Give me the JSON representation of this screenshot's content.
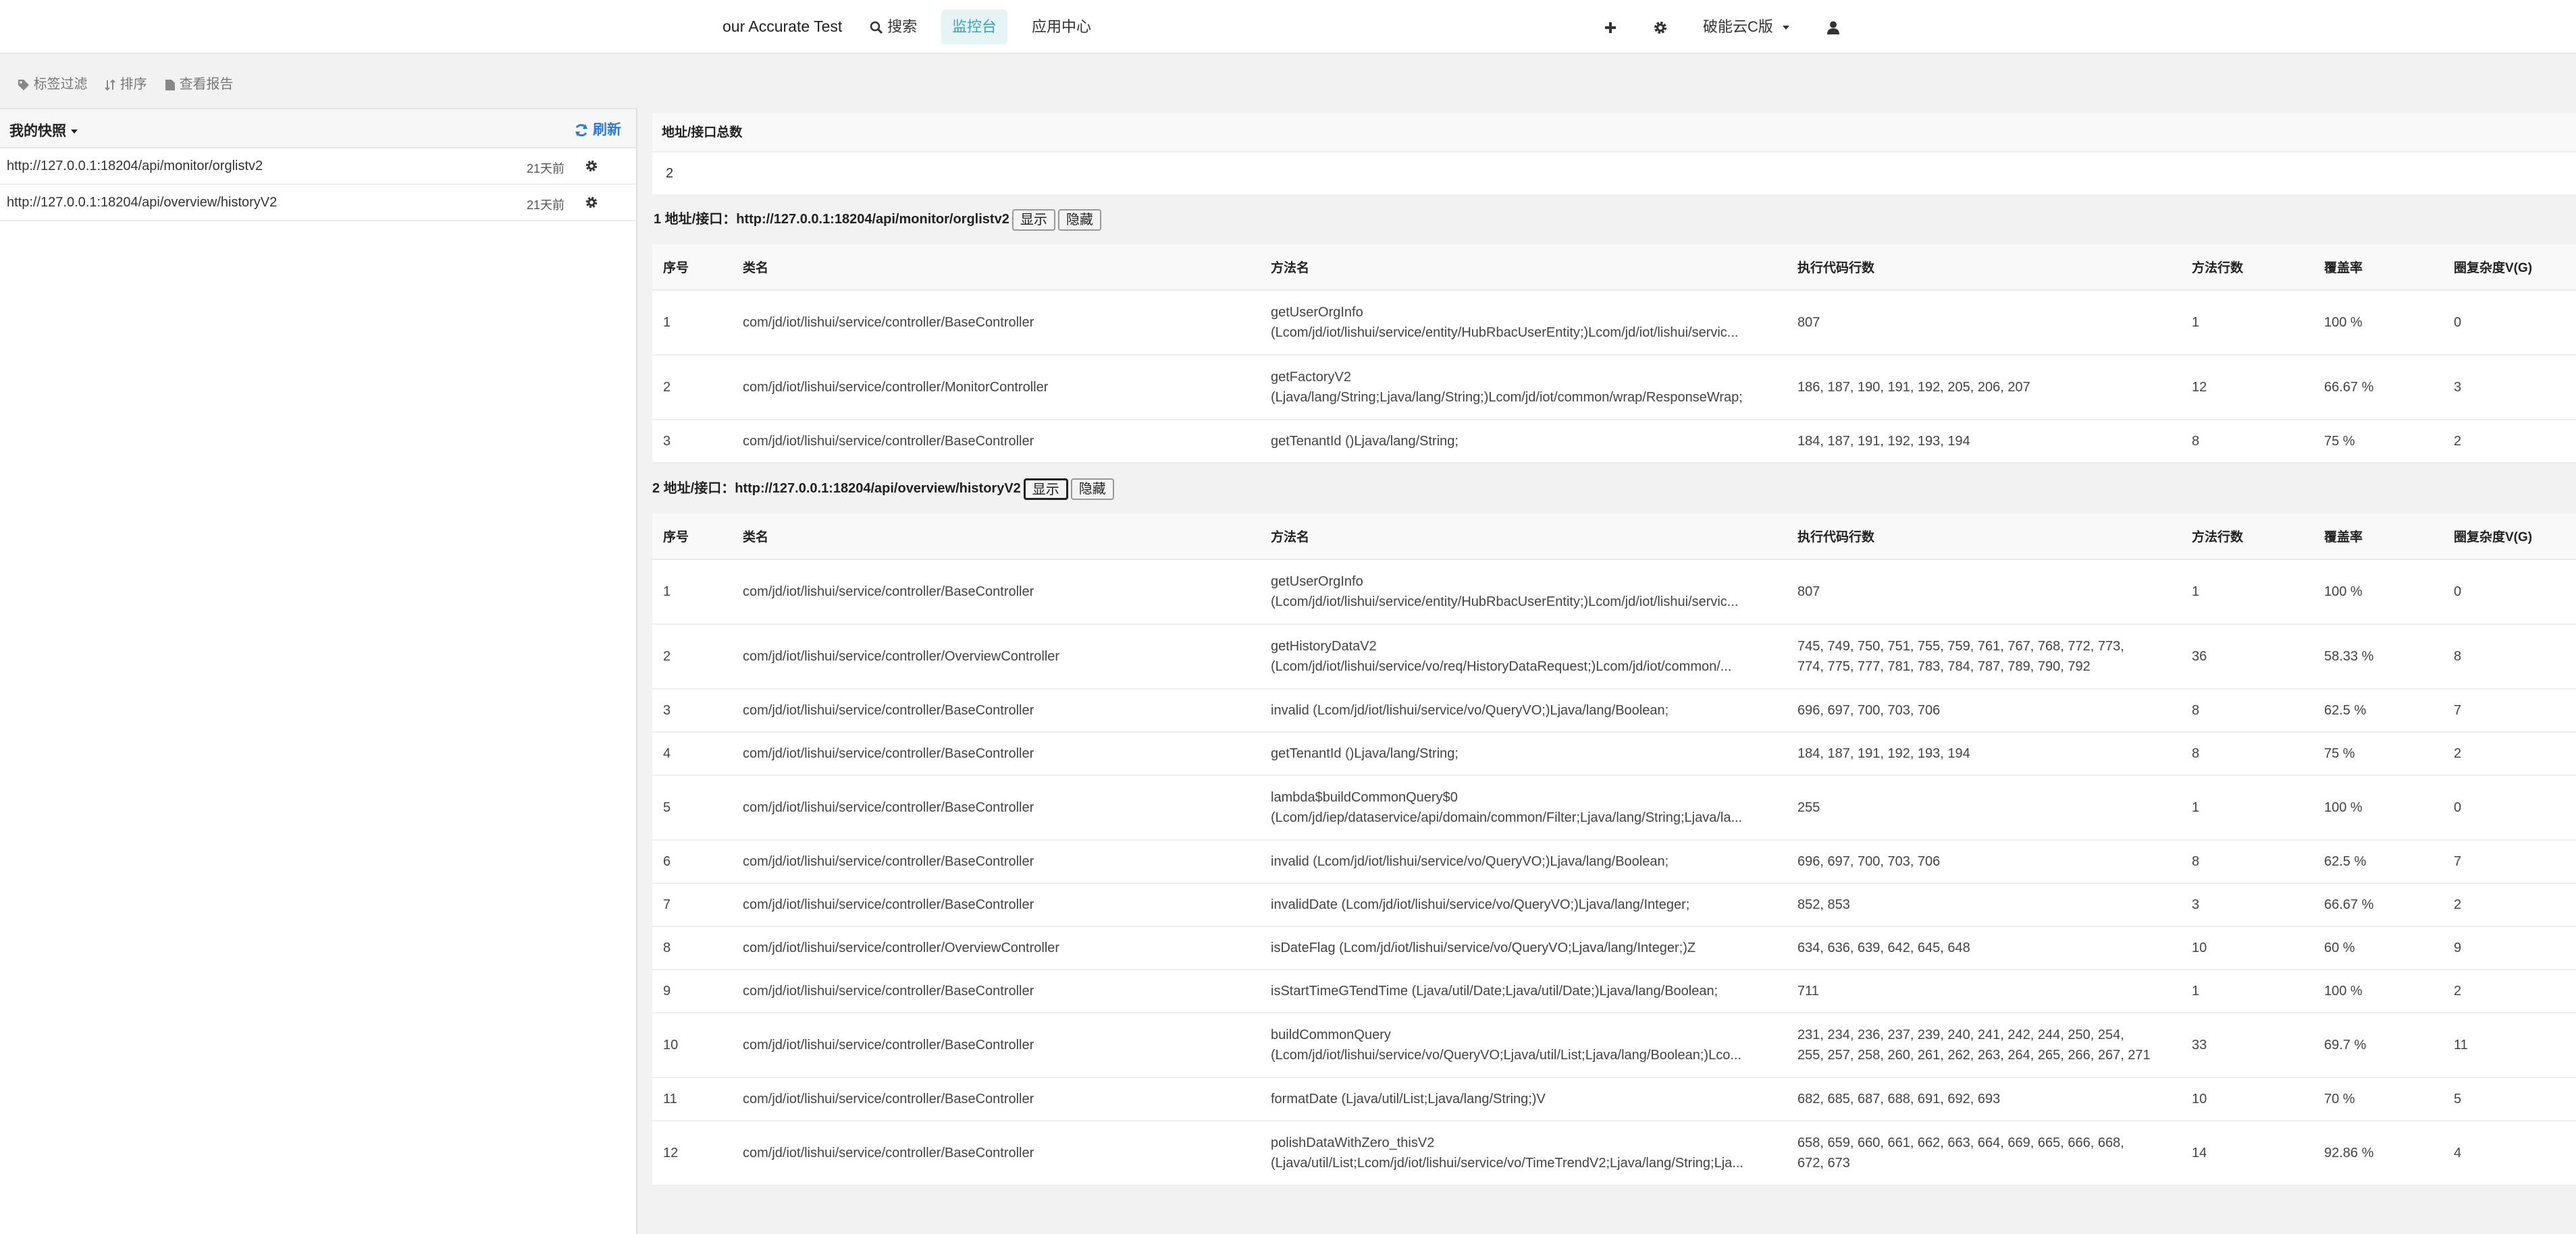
{
  "navbar": {
    "brand": "our Accurate Test",
    "search": "搜索",
    "monitor": "监控台",
    "app_center": "应用中心",
    "edition": "破能云C版"
  },
  "toolbar": {
    "tag_filter": "标签过滤",
    "sort": "排序",
    "view_report": "查看报告"
  },
  "snapshots": {
    "title": "我的快照",
    "refresh": "刷新",
    "items": [
      {
        "url": "http://127.0.0.1:18204/api/monitor/orglistv2",
        "time": "21天前"
      },
      {
        "url": "http://127.0.0.1:18204/api/overview/historyV2",
        "time": "21天前"
      }
    ]
  },
  "summary": {
    "header": "地址/接口总数",
    "value": "2"
  },
  "columns": [
    "序号",
    "类名",
    "方法名",
    "执行代码行数",
    "方法行数",
    "覆盖率",
    "圈复杂度V(G)"
  ],
  "sections": [
    {
      "title_prefix": "1 地址/接口：",
      "url": "http://127.0.0.1:18204/api/monitor/orglistv2",
      "show": "显示",
      "hide": "隐藏",
      "rows": [
        {
          "no": "1",
          "cls": "com/jd/iot/lishui/service/controller/BaseController",
          "m1": "getUserOrgInfo",
          "m2": "(Lcom/jd/iot/lishui/service/entity/HubRbacUserEntity;)Lcom/jd/iot/lishui/servic...",
          "lines": "807",
          "mlines": "1",
          "cov": "100 %",
          "vg": "0"
        },
        {
          "no": "2",
          "cls": "com/jd/iot/lishui/service/controller/MonitorController",
          "m1": "getFactoryV2",
          "m2": "(Ljava/lang/String;Ljava/lang/String;)Lcom/jd/iot/common/wrap/ResponseWrap;",
          "lines": "186, 187, 190, 191, 192, 205, 206, 207",
          "mlines": "12",
          "cov": "66.67 %",
          "vg": "3"
        },
        {
          "no": "3",
          "cls": "com/jd/iot/lishui/service/controller/BaseController",
          "m1": "getTenantId ()Ljava/lang/String;",
          "m2": "",
          "lines": "184, 187, 191, 192, 193, 194",
          "mlines": "8",
          "cov": "75 %",
          "vg": "2"
        }
      ]
    },
    {
      "title_prefix": "2 地址/接口：",
      "url": "http://127.0.0.1:18204/api/overview/historyV2",
      "show": "显示",
      "hide": "隐藏",
      "rows": [
        {
          "no": "1",
          "cls": "com/jd/iot/lishui/service/controller/BaseController",
          "m1": "getUserOrgInfo",
          "m2": "(Lcom/jd/iot/lishui/service/entity/HubRbacUserEntity;)Lcom/jd/iot/lishui/servic...",
          "lines": "807",
          "mlines": "1",
          "cov": "100 %",
          "vg": "0"
        },
        {
          "no": "2",
          "cls": "com/jd/iot/lishui/service/controller/OverviewController",
          "m1": "getHistoryDataV2",
          "m2": "(Lcom/jd/iot/lishui/service/vo/req/HistoryDataRequest;)Lcom/jd/iot/common/...",
          "lines": "745, 749, 750, 751, 755, 759, 761, 767, 768, 772, 773, 774, 775, 777, 781, 783, 784, 787, 789, 790, 792",
          "mlines": "36",
          "cov": "58.33 %",
          "vg": "8"
        },
        {
          "no": "3",
          "cls": "com/jd/iot/lishui/service/controller/BaseController",
          "m1": "invalid (Lcom/jd/iot/lishui/service/vo/QueryVO;)Ljava/lang/Boolean;",
          "m2": "",
          "lines": "696, 697, 700, 703, 706",
          "mlines": "8",
          "cov": "62.5 %",
          "vg": "7"
        },
        {
          "no": "4",
          "cls": "com/jd/iot/lishui/service/controller/BaseController",
          "m1": "getTenantId ()Ljava/lang/String;",
          "m2": "",
          "lines": "184, 187, 191, 192, 193, 194",
          "mlines": "8",
          "cov": "75 %",
          "vg": "2"
        },
        {
          "no": "5",
          "cls": "com/jd/iot/lishui/service/controller/BaseController",
          "m1": "lambda$buildCommonQuery$0",
          "m2": "(Lcom/jd/iep/dataservice/api/domain/common/Filter;Ljava/lang/String;Ljava/la...",
          "lines": "255",
          "mlines": "1",
          "cov": "100 %",
          "vg": "0"
        },
        {
          "no": "6",
          "cls": "com/jd/iot/lishui/service/controller/BaseController",
          "m1": "invalid (Lcom/jd/iot/lishui/service/vo/QueryVO;)Ljava/lang/Boolean;",
          "m2": "",
          "lines": "696, 697, 700, 703, 706",
          "mlines": "8",
          "cov": "62.5 %",
          "vg": "7"
        },
        {
          "no": "7",
          "cls": "com/jd/iot/lishui/service/controller/BaseController",
          "m1": "invalidDate (Lcom/jd/iot/lishui/service/vo/QueryVO;)Ljava/lang/Integer;",
          "m2": "",
          "lines": "852, 853",
          "mlines": "3",
          "cov": "66.67 %",
          "vg": "2"
        },
        {
          "no": "8",
          "cls": "com/jd/iot/lishui/service/controller/OverviewController",
          "m1": "isDateFlag (Lcom/jd/iot/lishui/service/vo/QueryVO;Ljava/lang/Integer;)Z",
          "m2": "",
          "lines": "634, 636, 639, 642, 645, 648",
          "mlines": "10",
          "cov": "60 %",
          "vg": "9"
        },
        {
          "no": "9",
          "cls": "com/jd/iot/lishui/service/controller/BaseController",
          "m1": "isStartTimeGTendTime (Ljava/util/Date;Ljava/util/Date;)Ljava/lang/Boolean;",
          "m2": "",
          "lines": "711",
          "mlines": "1",
          "cov": "100 %",
          "vg": "2"
        },
        {
          "no": "10",
          "cls": "com/jd/iot/lishui/service/controller/BaseController",
          "m1": "buildCommonQuery",
          "m2": "(Lcom/jd/iot/lishui/service/vo/QueryVO;Ljava/util/List;Ljava/lang/Boolean;)Lco...",
          "lines": "231, 234, 236, 237, 239, 240, 241, 242, 244, 250, 254, 255, 257, 258, 260, 261, 262, 263, 264, 265, 266, 267, 271",
          "mlines": "33",
          "cov": "69.7 %",
          "vg": "11"
        },
        {
          "no": "11",
          "cls": "com/jd/iot/lishui/service/controller/BaseController",
          "m1": "formatDate (Ljava/util/List;Ljava/lang/String;)V",
          "m2": "",
          "lines": "682, 685, 687, 688, 691, 692, 693",
          "mlines": "10",
          "cov": "70 %",
          "vg": "5"
        },
        {
          "no": "12",
          "cls": "com/jd/iot/lishui/service/controller/BaseController",
          "m1": "polishDataWithZero_thisV2",
          "m2": "(Ljava/util/List;Lcom/jd/iot/lishui/service/vo/TimeTrendV2;Ljava/lang/String;Lja...",
          "lines": "658, 659, 660, 661, 662, 663, 664, 669, 665, 666, 668, 672, 673",
          "mlines": "14",
          "cov": "92.86 %",
          "vg": "4"
        }
      ]
    }
  ]
}
